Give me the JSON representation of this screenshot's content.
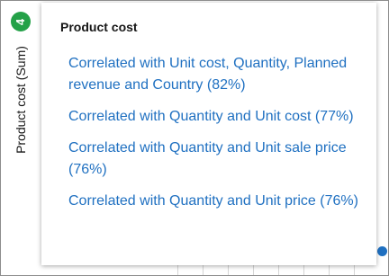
{
  "axis": {
    "badge": "4",
    "label": "Product cost (Sum)"
  },
  "tooltip": {
    "title": "Product cost",
    "items": [
      "Correlated with Unit cost, Quantity, Planned revenue and Country (82%)",
      "Correlated with Quantity and Unit cost (77%)",
      "Correlated with Quantity and Unit sale price (76%)",
      "Correlated with Quantity and Unit price (76%)"
    ]
  },
  "colors": {
    "link": "#1f70c1",
    "badge": "#24a148"
  }
}
